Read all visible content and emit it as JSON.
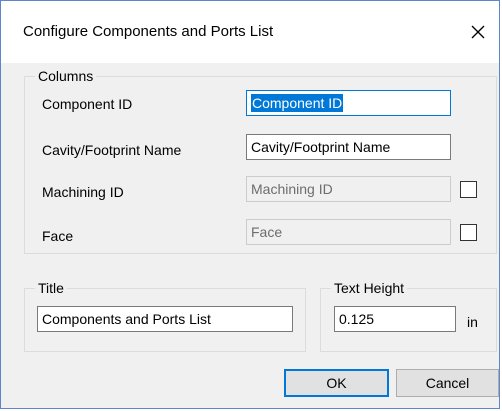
{
  "window": {
    "title": "Configure Components and Ports List",
    "close_icon": "close-icon"
  },
  "columns": {
    "group_label": "Columns",
    "rows": [
      {
        "label": "Component ID",
        "value": "Component ID",
        "enabled": true,
        "focused": true,
        "has_checkbox": false
      },
      {
        "label": "Cavity/Footprint Name",
        "value": "Cavity/Footprint Name",
        "enabled": true,
        "focused": false,
        "has_checkbox": false
      },
      {
        "label": "Machining ID",
        "value": "Machining ID",
        "enabled": false,
        "focused": false,
        "has_checkbox": true,
        "checked": false
      },
      {
        "label": "Face",
        "value": "Face",
        "enabled": false,
        "focused": false,
        "has_checkbox": true,
        "checked": false
      }
    ]
  },
  "title_group": {
    "group_label": "Title",
    "value": "Components and Ports List"
  },
  "text_height_group": {
    "group_label": "Text Height",
    "value": "0.125",
    "unit": "in"
  },
  "buttons": {
    "ok_label": "OK",
    "cancel_label": "Cancel"
  },
  "colors": {
    "accent": "#0078d7",
    "dialog_bg": "#f0f0f0",
    "window_border": "#5d87c8"
  }
}
